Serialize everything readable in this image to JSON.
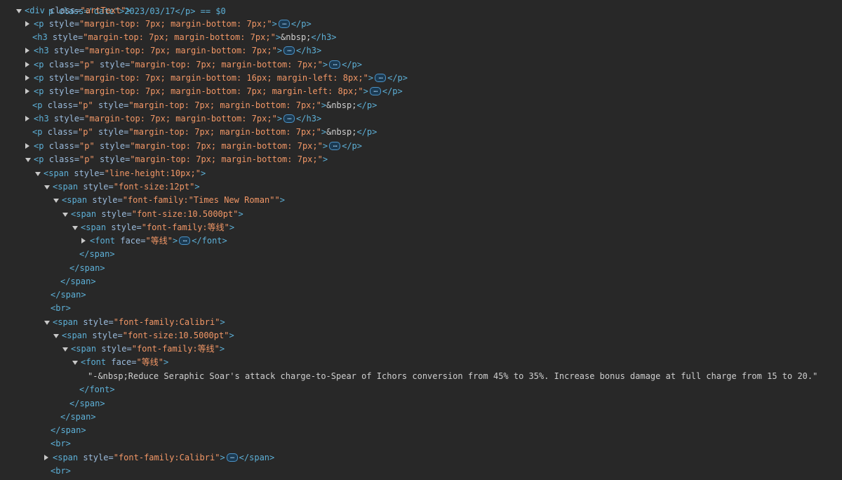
{
  "theme": {
    "background": "#282828",
    "tag_color": "#5db0d7",
    "attr_color": "#9bbbdc",
    "value_color": "#f29766",
    "text_color": "#cfcfcf"
  },
  "top_fragment": "p class=\"date\">2023/03/17</p> == $0",
  "lines": [
    {
      "toggle": "open",
      "parts": [
        [
          "tag",
          "<div "
        ],
        [
          "attr",
          "class"
        ],
        [
          "eq",
          "="
        ],
        [
          "val",
          "\"artText\""
        ],
        [
          "tag",
          ">"
        ]
      ]
    },
    {
      "toggle": "closed",
      "parts": [
        [
          "tag",
          "<p "
        ],
        [
          "attr",
          "style"
        ],
        [
          "eq",
          "="
        ],
        [
          "val",
          "\"margin-top: 7px; margin-bottom: 7px;\""
        ],
        [
          "tag",
          ">"
        ],
        [
          "ellipsis",
          "…"
        ],
        [
          "tag",
          "</p>"
        ]
      ]
    },
    {
      "toggle": "none",
      "parts": [
        [
          "tag",
          "<h3 "
        ],
        [
          "attr",
          "style"
        ],
        [
          "eq",
          "="
        ],
        [
          "val",
          "\"margin-top: 7px; margin-bottom: 7px;\""
        ],
        [
          "tag",
          ">"
        ],
        [
          "ent",
          "&nbsp;"
        ],
        [
          "tag",
          "</h3>"
        ]
      ]
    },
    {
      "toggle": "closed",
      "parts": [
        [
          "tag",
          "<h3 "
        ],
        [
          "attr",
          "style"
        ],
        [
          "eq",
          "="
        ],
        [
          "val",
          "\"margin-top: 7px; margin-bottom: 7px;\""
        ],
        [
          "tag",
          ">"
        ],
        [
          "ellipsis",
          "…"
        ],
        [
          "tag",
          "</h3>"
        ]
      ]
    },
    {
      "toggle": "closed",
      "parts": [
        [
          "tag",
          "<p "
        ],
        [
          "attr",
          "class"
        ],
        [
          "eq",
          "="
        ],
        [
          "val",
          "\"p\" "
        ],
        [
          "attr",
          "style"
        ],
        [
          "eq",
          "="
        ],
        [
          "val",
          "\"margin-top: 7px; margin-bottom: 7px;\""
        ],
        [
          "tag",
          ">"
        ],
        [
          "ellipsis",
          "…"
        ],
        [
          "tag",
          "</p>"
        ]
      ]
    },
    {
      "toggle": "closed",
      "parts": [
        [
          "tag",
          "<p "
        ],
        [
          "attr",
          "style"
        ],
        [
          "eq",
          "="
        ],
        [
          "val",
          "\"margin-top: 7px; margin-bottom: 16px; margin-left: 8px;\""
        ],
        [
          "tag",
          ">"
        ],
        [
          "ellipsis",
          "…"
        ],
        [
          "tag",
          "</p>"
        ]
      ]
    },
    {
      "toggle": "closed",
      "parts": [
        [
          "tag",
          "<p "
        ],
        [
          "attr",
          "style"
        ],
        [
          "eq",
          "="
        ],
        [
          "val",
          "\"margin-top: 7px; margin-bottom: 7px; margin-left: 8px;\""
        ],
        [
          "tag",
          ">"
        ],
        [
          "ellipsis",
          "…"
        ],
        [
          "tag",
          "</p>"
        ]
      ]
    },
    {
      "toggle": "none",
      "parts": [
        [
          "tag",
          "<p "
        ],
        [
          "attr",
          "class"
        ],
        [
          "eq",
          "="
        ],
        [
          "val",
          "\"p\" "
        ],
        [
          "attr",
          "style"
        ],
        [
          "eq",
          "="
        ],
        [
          "val",
          "\"margin-top: 7px; margin-bottom: 7px;\""
        ],
        [
          "tag",
          ">"
        ],
        [
          "ent",
          "&nbsp;"
        ],
        [
          "tag",
          "</p>"
        ]
      ]
    },
    {
      "toggle": "closed",
      "parts": [
        [
          "tag",
          "<h3 "
        ],
        [
          "attr",
          "style"
        ],
        [
          "eq",
          "="
        ],
        [
          "val",
          "\"margin-top: 7px; margin-bottom: 7px;\""
        ],
        [
          "tag",
          ">"
        ],
        [
          "ellipsis",
          "…"
        ],
        [
          "tag",
          "</h3>"
        ]
      ]
    },
    {
      "toggle": "none",
      "parts": [
        [
          "tag",
          "<p "
        ],
        [
          "attr",
          "class"
        ],
        [
          "eq",
          "="
        ],
        [
          "val",
          "\"p\" "
        ],
        [
          "attr",
          "style"
        ],
        [
          "eq",
          "="
        ],
        [
          "val",
          "\"margin-top: 7px; margin-bottom: 7px;\""
        ],
        [
          "tag",
          ">"
        ],
        [
          "ent",
          "&nbsp;"
        ],
        [
          "tag",
          "</p>"
        ]
      ]
    },
    {
      "toggle": "closed",
      "parts": [
        [
          "tag",
          "<p "
        ],
        [
          "attr",
          "class"
        ],
        [
          "eq",
          "="
        ],
        [
          "val",
          "\"p\" "
        ],
        [
          "attr",
          "style"
        ],
        [
          "eq",
          "="
        ],
        [
          "val",
          "\"margin-top: 7px; margin-bottom: 7px;\""
        ],
        [
          "tag",
          ">"
        ],
        [
          "ellipsis",
          "…"
        ],
        [
          "tag",
          "</p>"
        ]
      ]
    },
    {
      "toggle": "open",
      "parts": [
        [
          "tag",
          "<p "
        ],
        [
          "attr",
          "class"
        ],
        [
          "eq",
          "="
        ],
        [
          "val",
          "\"p\" "
        ],
        [
          "attr",
          "style"
        ],
        [
          "eq",
          "="
        ],
        [
          "val",
          "\"margin-top: 7px; margin-bottom: 7px;\""
        ],
        [
          "tag",
          ">"
        ]
      ]
    },
    {
      "toggle": "open",
      "parts": [
        [
          "tag",
          "<span "
        ],
        [
          "attr",
          "style"
        ],
        [
          "eq",
          "="
        ],
        [
          "val",
          "\"line-height:10px;\""
        ],
        [
          "tag",
          ">"
        ]
      ]
    },
    {
      "toggle": "open",
      "parts": [
        [
          "tag",
          "<span "
        ],
        [
          "attr",
          "style"
        ],
        [
          "eq",
          "="
        ],
        [
          "val",
          "\"font-size:12pt\""
        ],
        [
          "tag",
          ">"
        ]
      ]
    },
    {
      "toggle": "open",
      "parts": [
        [
          "tag",
          "<span "
        ],
        [
          "attr",
          "style"
        ],
        [
          "eq",
          "="
        ],
        [
          "val",
          "\"font-family:\"Times New Roman\"\""
        ],
        [
          "tag",
          ">"
        ]
      ]
    },
    {
      "toggle": "open",
      "parts": [
        [
          "tag",
          "<span "
        ],
        [
          "attr",
          "style"
        ],
        [
          "eq",
          "="
        ],
        [
          "val",
          "\"font-size:10.5000pt\""
        ],
        [
          "tag",
          ">"
        ]
      ]
    },
    {
      "toggle": "open",
      "parts": [
        [
          "tag",
          "<span "
        ],
        [
          "attr",
          "style"
        ],
        [
          "eq",
          "="
        ],
        [
          "val",
          "\"font-family:等线\""
        ],
        [
          "tag",
          ">"
        ]
      ]
    },
    {
      "toggle": "closed",
      "parts": [
        [
          "tag",
          "<font "
        ],
        [
          "attr",
          "face"
        ],
        [
          "eq",
          "="
        ],
        [
          "val",
          "\"等线\""
        ],
        [
          "tag",
          ">"
        ],
        [
          "ellipsis",
          "…"
        ],
        [
          "tag",
          "</font>"
        ]
      ]
    },
    {
      "toggle": "none",
      "parts": [
        [
          "tag",
          "</span>"
        ]
      ]
    },
    {
      "toggle": "none",
      "parts": [
        [
          "tag",
          "</span>"
        ]
      ]
    },
    {
      "toggle": "none",
      "parts": [
        [
          "tag",
          "</span>"
        ]
      ]
    },
    {
      "toggle": "none",
      "parts": [
        [
          "tag",
          "</span>"
        ]
      ]
    },
    {
      "toggle": "none",
      "parts": [
        [
          "tag",
          "<br>"
        ]
      ]
    },
    {
      "toggle": "open",
      "parts": [
        [
          "tag",
          "<span "
        ],
        [
          "attr",
          "style"
        ],
        [
          "eq",
          "="
        ],
        [
          "val",
          "\"font-family:Calibri\""
        ],
        [
          "tag",
          ">"
        ]
      ]
    },
    {
      "toggle": "open",
      "parts": [
        [
          "tag",
          "<span "
        ],
        [
          "attr",
          "style"
        ],
        [
          "eq",
          "="
        ],
        [
          "val",
          "\"font-size:10.5000pt\""
        ],
        [
          "tag",
          ">"
        ]
      ]
    },
    {
      "toggle": "open",
      "parts": [
        [
          "tag",
          "<span "
        ],
        [
          "attr",
          "style"
        ],
        [
          "eq",
          "="
        ],
        [
          "val",
          "\"font-family:等线\""
        ],
        [
          "tag",
          ">"
        ]
      ]
    },
    {
      "toggle": "open",
      "parts": [
        [
          "tag",
          "<font "
        ],
        [
          "attr",
          "face"
        ],
        [
          "eq",
          "="
        ],
        [
          "val",
          "\"等线\""
        ],
        [
          "tag",
          ">"
        ]
      ]
    },
    {
      "toggle": "none",
      "parts": [
        [
          "txt",
          "\"-&nbsp;Reduce Seraphic Soar's attack charge-to-Spear of Ichors conversion from 45% to 35%. Increase bonus damage at full charge from 15 to 20.\""
        ]
      ]
    },
    {
      "toggle": "none",
      "parts": [
        [
          "tag",
          "</font>"
        ]
      ]
    },
    {
      "toggle": "none",
      "parts": [
        [
          "tag",
          "</span>"
        ]
      ]
    },
    {
      "toggle": "none",
      "parts": [
        [
          "tag",
          "</span>"
        ]
      ]
    },
    {
      "toggle": "none",
      "parts": [
        [
          "tag",
          "</span>"
        ]
      ]
    },
    {
      "toggle": "none",
      "parts": [
        [
          "tag",
          "<br>"
        ]
      ]
    },
    {
      "toggle": "closed",
      "parts": [
        [
          "tag",
          "<span "
        ],
        [
          "attr",
          "style"
        ],
        [
          "eq",
          "="
        ],
        [
          "val",
          "\"font-family:Calibri\""
        ],
        [
          "tag",
          ">"
        ],
        [
          "ellipsis",
          "…"
        ],
        [
          "tag",
          "</span>"
        ]
      ]
    },
    {
      "toggle": "none",
      "parts": [
        [
          "tag",
          "<br>"
        ]
      ]
    }
  ]
}
